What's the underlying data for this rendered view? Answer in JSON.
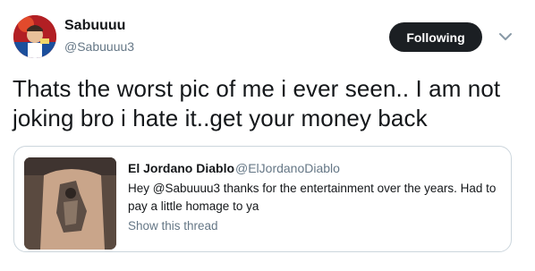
{
  "author": {
    "name": "Sabuuuu",
    "handle": "@Sabuuuu3"
  },
  "follow_button": {
    "label": "Following"
  },
  "icons": {
    "more": "chevron-down-icon",
    "avatar": "profile-photo",
    "quote_image": "tattoo-photo"
  },
  "tweet": {
    "text": "Thats the worst pic of me i ever seen.. I am not joking bro i hate it..get your money  back"
  },
  "quoted": {
    "name": "El Jordano Diablo",
    "handle": "@ElJordanoDiablo",
    "text": "Hey @Sabuuuu3 thanks for the entertainment over the years. Had to pay a little homage to ya",
    "link": "Show this thread"
  },
  "colors": {
    "button_bg": "#1b1f23",
    "secondary_text": "#657786",
    "border": "#ccd6dd"
  }
}
